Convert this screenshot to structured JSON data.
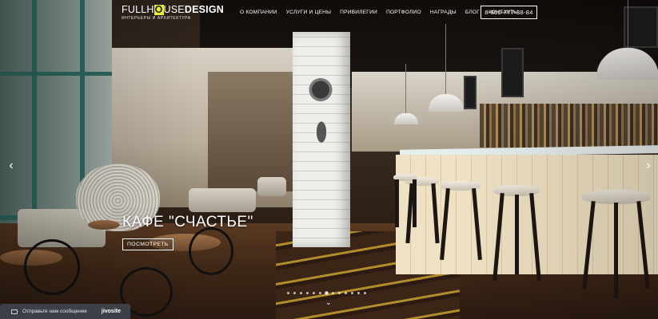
{
  "logo": {
    "prefix": "FULLH",
    "house": "O",
    "suffix_light": "USE",
    "suffix_bold": "DESIGN",
    "tagline": "интерьеры и архитектура"
  },
  "nav": {
    "items": [
      "О КОМПАНИИ",
      "УСЛУГИ И ЦЕНЫ",
      "ПРИВИЛЕГИИ",
      "ПОРТФОЛИО",
      "НАГРАДЫ",
      "БЛОГ",
      "КОНТАКТЫ"
    ]
  },
  "phone": "8-800-777-38-84",
  "slider": {
    "title": "КАФЕ \"СЧАСТЬЕ\"",
    "button_label": "ПОСМОТРЕТЬ",
    "prev_icon": "‹",
    "next_icon": "›",
    "dots_count": 13,
    "active_dot": 6,
    "scroll_icon": "⌄"
  },
  "chat": {
    "label": "Отправьте нам сообщение",
    "brand": "jivosite"
  },
  "colors": {
    "logo_accent": "#e7ee3a",
    "chat_bg": "#3d4147"
  }
}
